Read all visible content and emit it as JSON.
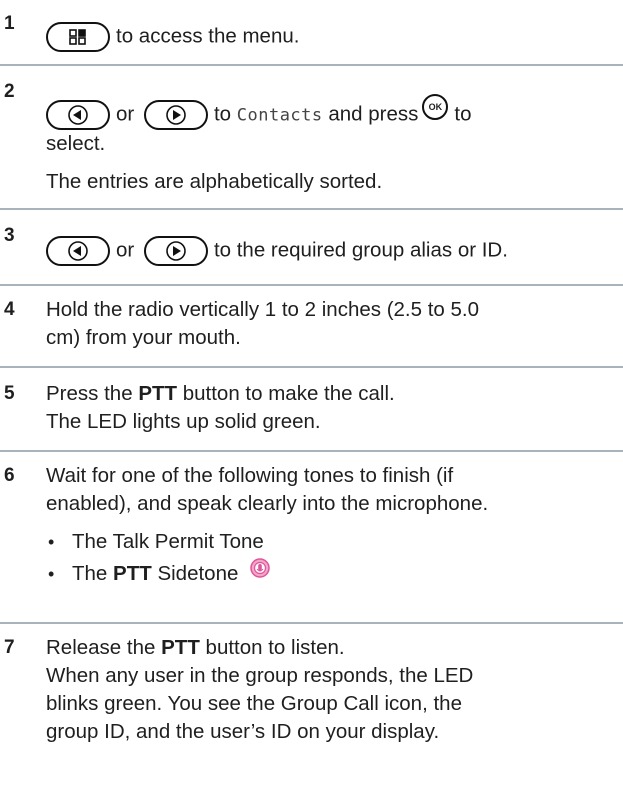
{
  "steps": [
    {
      "number": "1",
      "text": "to access the menu."
    },
    {
      "number": "2",
      "or": "or",
      "to": "to",
      "lcd": "Contacts",
      "press": "and press",
      "ok_label": "OK",
      "to2": "to",
      "line2": "select.",
      "note": "The entries are alphabetically sorted."
    },
    {
      "number": "3",
      "or": "or",
      "text": "to the required group alias or ID."
    },
    {
      "number": "4",
      "line1": "Hold the radio vertically 1 to 2 inches (2.5 to 5.0",
      "line2": "cm) from your mouth."
    },
    {
      "number": "5",
      "pre": "Press the",
      "bold": "PTT",
      "post": "button to make the call.",
      "line2": "The LED lights up solid green."
    },
    {
      "number": "6",
      "line1": "Wait for one of the following tones to finish (if",
      "line2": "enabled), and speak clearly into the microphone.",
      "bullets": [
        {
          "text": "The Talk Permit Tone"
        },
        {
          "pre": "The",
          "bold": "PTT",
          "post": "Sidetone"
        }
      ]
    },
    {
      "number": "7",
      "pre": "Release the",
      "bold": "PTT",
      "post": "button to listen.",
      "line2": "When any user in the group responds, the LED",
      "line3": "blinks green. You see the Group Call icon, the",
      "line4": "group ID, and the user’s ID on your display."
    }
  ],
  "colors": {
    "divider": "#a8b3bc",
    "sidetone_icon": "#e0559a"
  },
  "icons": {
    "menu_key": "menu-grid-icon",
    "left_key": "left-arrow-key-icon",
    "right_key": "right-arrow-key-icon",
    "ok_key": "ok-key-icon",
    "sidetone": "sidetone-icon"
  }
}
